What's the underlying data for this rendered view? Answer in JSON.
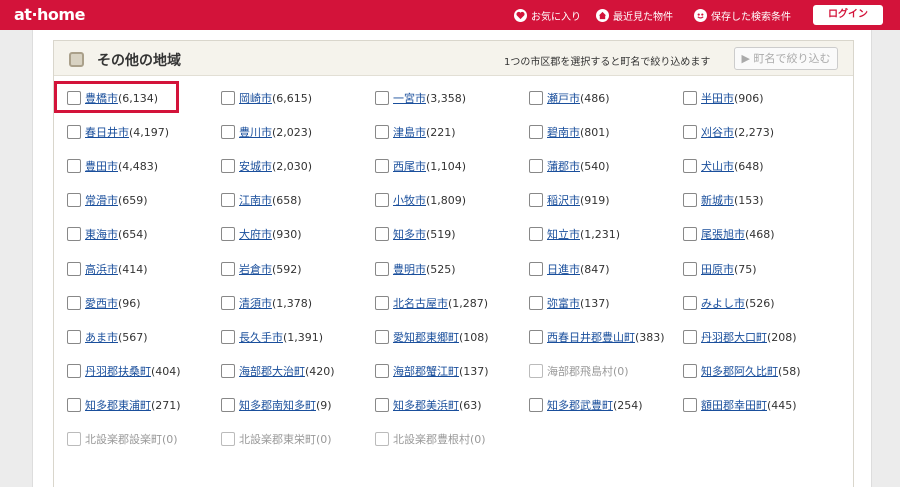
{
  "header": {
    "logo": "at·home",
    "favorites": "お気に入り",
    "recent": "最近見た物件",
    "saved_search": "保存した検索条件",
    "login": "ログイン"
  },
  "section": {
    "title": "その他の地域",
    "note": "1つの市区郡を選択すると町名で絞り込めます",
    "narrow_button": "▶ 町名で絞り込む"
  },
  "cities": [
    [
      {
        "name": "豊橋市",
        "count": "(6,134)"
      },
      {
        "name": "岡崎市",
        "count": "(6,615)"
      },
      {
        "name": "一宮市",
        "count": "(3,358)"
      },
      {
        "name": "瀬戸市",
        "count": "(486)"
      },
      {
        "name": "半田市",
        "count": "(906)"
      }
    ],
    [
      {
        "name": "春日井市",
        "count": "(4,197)"
      },
      {
        "name": "豊川市",
        "count": "(2,023)"
      },
      {
        "name": "津島市",
        "count": "(221)"
      },
      {
        "name": "碧南市",
        "count": "(801)"
      },
      {
        "name": "刈谷市",
        "count": "(2,273)"
      }
    ],
    [
      {
        "name": "豊田市",
        "count": "(4,483)"
      },
      {
        "name": "安城市",
        "count": "(2,030)"
      },
      {
        "name": "西尾市",
        "count": "(1,104)"
      },
      {
        "name": "蒲郡市",
        "count": "(540)"
      },
      {
        "name": "犬山市",
        "count": "(648)"
      }
    ],
    [
      {
        "name": "常滑市",
        "count": "(659)"
      },
      {
        "name": "江南市",
        "count": "(658)"
      },
      {
        "name": "小牧市",
        "count": "(1,809)"
      },
      {
        "name": "稲沢市",
        "count": "(919)"
      },
      {
        "name": "新城市",
        "count": "(153)"
      }
    ],
    [
      {
        "name": "東海市",
        "count": "(654)"
      },
      {
        "name": "大府市",
        "count": "(930)"
      },
      {
        "name": "知多市",
        "count": "(519)"
      },
      {
        "name": "知立市",
        "count": "(1,231)"
      },
      {
        "name": "尾張旭市",
        "count": "(468)"
      }
    ],
    [
      {
        "name": "高浜市",
        "count": "(414)"
      },
      {
        "name": "岩倉市",
        "count": "(592)"
      },
      {
        "name": "豊明市",
        "count": "(525)"
      },
      {
        "name": "日進市",
        "count": "(847)"
      },
      {
        "name": "田原市",
        "count": "(75)"
      }
    ],
    [
      {
        "name": "愛西市",
        "count": "(96)"
      },
      {
        "name": "清須市",
        "count": "(1,378)"
      },
      {
        "name": "北名古屋市",
        "count": "(1,287)"
      },
      {
        "name": "弥富市",
        "count": "(137)"
      },
      {
        "name": "みよし市",
        "count": "(526)"
      }
    ],
    [
      {
        "name": "あま市",
        "count": "(567)"
      },
      {
        "name": "長久手市",
        "count": "(1,391)"
      },
      {
        "name": "愛知郡東郷町",
        "count": "(108)"
      },
      {
        "name": "西春日井郡豊山町",
        "count": "(383)"
      },
      {
        "name": "丹羽郡大口町",
        "count": "(208)"
      }
    ],
    [
      {
        "name": "丹羽郡扶桑町",
        "count": "(404)"
      },
      {
        "name": "海部郡大治町",
        "count": "(420)"
      },
      {
        "name": "海部郡蟹江町",
        "count": "(137)"
      },
      {
        "name": "海部郡飛島村",
        "count": "(0)",
        "disabled": true
      },
      {
        "name": "知多郡阿久比町",
        "count": "(58)"
      }
    ],
    [
      {
        "name": "知多郡東浦町",
        "count": "(271)"
      },
      {
        "name": "知多郡南知多町",
        "count": "(9)"
      },
      {
        "name": "知多郡美浜町",
        "count": "(63)"
      },
      {
        "name": "知多郡武豊町",
        "count": "(254)"
      },
      {
        "name": "額田郡幸田町",
        "count": "(445)"
      }
    ],
    [
      {
        "name": "北設楽郡設楽町",
        "count": "(0)",
        "disabled": true
      },
      {
        "name": "北設楽郡東栄町",
        "count": "(0)",
        "disabled": true
      },
      {
        "name": "北設楽郡豊根村",
        "count": "(0)",
        "disabled": true
      }
    ]
  ],
  "colors": {
    "brand": "#d3133a",
    "link": "#1a4f9c"
  }
}
